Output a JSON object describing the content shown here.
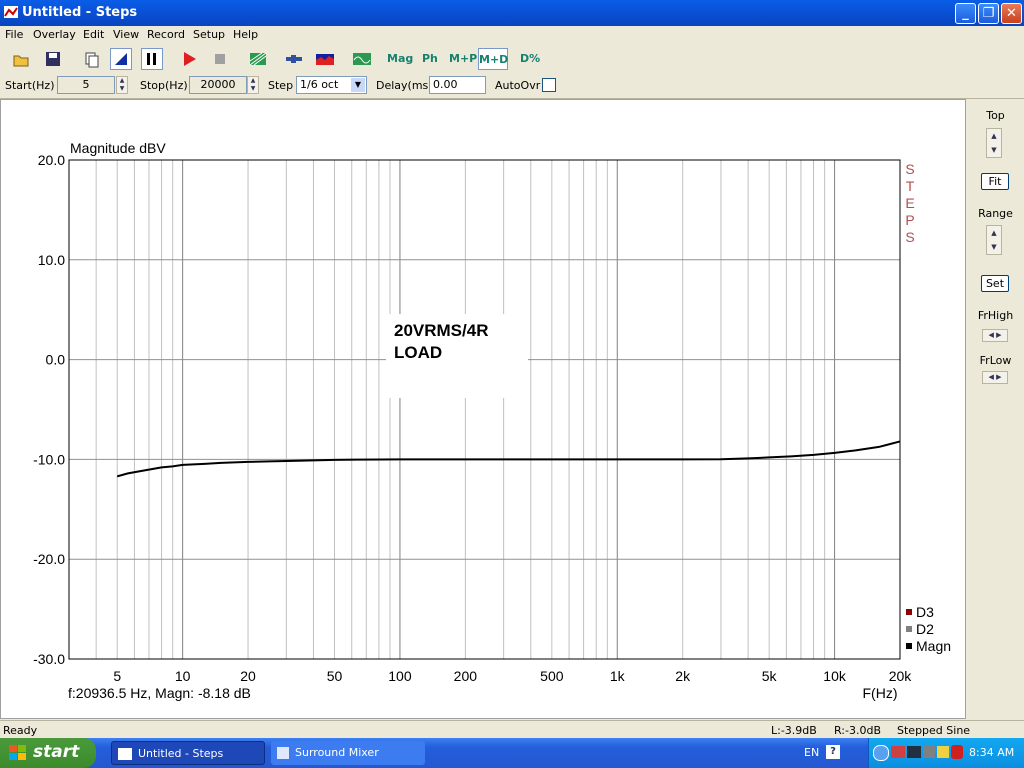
{
  "window": {
    "title": "Untitled - Steps"
  },
  "menu": [
    "File",
    "Overlay",
    "Edit",
    "View",
    "Record",
    "Setup",
    "Help"
  ],
  "toolbar": {
    "mag": "Mag",
    "ph": "Ph",
    "mp": "M+P",
    "md": "M+D",
    "dpct": "D%"
  },
  "params": {
    "start_label": "Start(Hz)",
    "start_value": "5",
    "stop_label": "Stop(Hz)",
    "stop_value": "20000",
    "step_label": "Step",
    "step_value": "1/6 oct",
    "delay_label": "Delay(ms)",
    "delay_value": "0.00",
    "autoovr_label": "AutoOvr",
    "autoovr_checked": false
  },
  "right_panel": {
    "top_label": "Top",
    "fit_label": "Fit",
    "range_label": "Range",
    "set_label": "Set",
    "frhigh_label": "FrHigh",
    "frlow_label": "FrLow"
  },
  "chart_data": {
    "type": "line",
    "title": "Magnitude dBV",
    "watermark": "STEPS",
    "annotation": [
      "20VRMS/4R",
      "LOAD"
    ],
    "xlabel": "F(Hz)",
    "x_scale": "log",
    "xlim": [
      3,
      20000
    ],
    "ylim": [
      -30,
      20
    ],
    "yticks": [
      "20.0",
      "10.0",
      "0.0",
      "-10.0",
      "-20.0",
      "-30.0"
    ],
    "xticks": [
      {
        "v": 5,
        "l": "5"
      },
      {
        "v": 10,
        "l": "10"
      },
      {
        "v": 20,
        "l": "20"
      },
      {
        "v": 50,
        "l": "50"
      },
      {
        "v": 100,
        "l": "100"
      },
      {
        "v": 200,
        "l": "200"
      },
      {
        "v": 500,
        "l": "500"
      },
      {
        "v": 1000,
        "l": "1k"
      },
      {
        "v": 2000,
        "l": "2k"
      },
      {
        "v": 5000,
        "l": "5k"
      },
      {
        "v": 10000,
        "l": "10k"
      },
      {
        "v": 20000,
        "l": "20k"
      }
    ],
    "grid": true,
    "legend": {
      "position": "bottom-right",
      "items": [
        {
          "name": "D3",
          "color": "#8b0000"
        },
        {
          "name": "D2",
          "color": "#808080"
        },
        {
          "name": "Magn",
          "color": "#000000"
        }
      ]
    },
    "series": [
      {
        "name": "Magn",
        "color": "#000000",
        "x": [
          5,
          5.6,
          6.3,
          7.1,
          8,
          9,
          10,
          12.6,
          15,
          20,
          25,
          32,
          40,
          50,
          63,
          100,
          200,
          500,
          1000,
          2000,
          3000,
          4000,
          5000,
          6300,
          8000,
          10000,
          12500,
          16000,
          20000
        ],
        "y": [
          -11.7,
          -11.4,
          -11.2,
          -11.0,
          -10.8,
          -10.7,
          -10.55,
          -10.45,
          -10.35,
          -10.25,
          -10.2,
          -10.15,
          -10.1,
          -10.05,
          -10.02,
          -10.0,
          -10.0,
          -10.0,
          -10.0,
          -10.0,
          -9.98,
          -9.9,
          -9.8,
          -9.7,
          -9.55,
          -9.35,
          -9.1,
          -8.75,
          -8.2
        ]
      }
    ],
    "cursor_readout": "f:20936.5 Hz, Magn: -8.18 dB"
  },
  "status": {
    "left": "Ready",
    "l": "L:-3.9dB",
    "r": "R:-3.0dB",
    "mode": "Stepped Sine Response"
  },
  "taskbar": {
    "start": "start",
    "task1": "Untitled - Steps",
    "task2": "Surround Mixer",
    "lang": "EN",
    "clock": "8:34 AM"
  }
}
